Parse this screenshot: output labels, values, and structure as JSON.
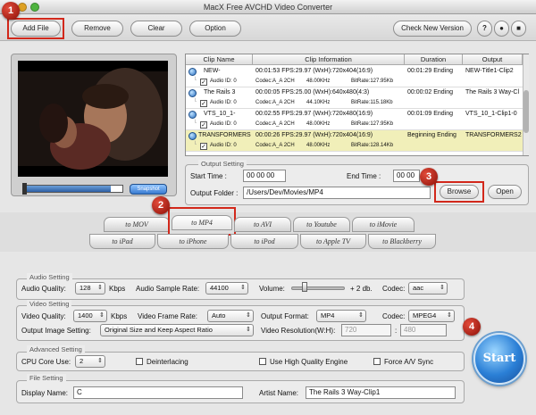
{
  "window": {
    "title": "MacX Free AVCHD Video Converter"
  },
  "toolbar": {
    "add_file": "Add File",
    "remove": "Remove",
    "clear": "Clear",
    "option": "Option",
    "check_version": "Check New Version"
  },
  "callouts": [
    "1",
    "2",
    "3",
    "4"
  ],
  "preview": {
    "snapshot_label": "Snapshot",
    "progress": 0.88
  },
  "table": {
    "headers": [
      "Clip Name",
      "Clip Information",
      "Duration",
      "Output"
    ],
    "rows": [
      {
        "name": "NEW-",
        "info": "00:01:53  FPS:29.97  (WxH):720x404(16:9)",
        "duration": "00:01:29 Ending",
        "output": "NEW-Title1-Clip2",
        "audio_id": "Audio ID: 0",
        "codec": "Codec:A_A 2CH",
        "hz": "48.00KHz",
        "bitrate": "BitRate:127.95Kb"
      },
      {
        "name": "The Rails 3",
        "info": "00:00:05  FPS:25.00  (WxH):640x480(4:3)",
        "duration": "00:00:02 Ending",
        "output": "The Rails 3 Way-Cl",
        "audio_id": "Audio ID: 0",
        "codec": "Codec:A_A 2CH",
        "hz": "44.10KHz",
        "bitrate": "BitRate:115.18Kb"
      },
      {
        "name": "VTS_10_1-",
        "info": "00:02:55  FPS:29.97  (WxH):720x480(16:9)",
        "duration": "00:01:09 Ending",
        "output": "VTS_10_1-Clip1-0",
        "audio_id": "Audio ID: 0",
        "codec": "Codec:A_A 2CH",
        "hz": "48.00KHz",
        "bitrate": "BitRate:127.95Kb"
      },
      {
        "name": "TRANSFORMERS",
        "info": "00:00:26  FPS:29.97  (WxH):720x404(16:9)",
        "duration": "Beginning Ending",
        "output": "TRANSFORMERS2",
        "audio_id": "Audio ID: 0",
        "codec": "Codec:A_A 2CH",
        "hz": "48.00KHz",
        "bitrate": "BitRate:128.14Kb"
      }
    ]
  },
  "output_setting": {
    "title": "Output Setting",
    "start_time_label": "Start Time :",
    "start_time": "00  00  00",
    "end_time_label": "End Time :",
    "end_time": "00  00",
    "folder_label": "Output Folder :",
    "folder": "/Users/Dev/Movies/MP4",
    "browse": "Browse",
    "open": "Open"
  },
  "format_tabs_row1": [
    "to MOV",
    "to MP4",
    "to AVI",
    "to Youtube",
    "to iMovie"
  ],
  "format_tabs_row2": [
    "to iPad",
    "to iPhone",
    "to iPod",
    "to Apple TV",
    "to Blackberry"
  ],
  "audio": {
    "title": "Audio Setting",
    "quality_label": "Audio Quality:",
    "quality": "128",
    "kbps": "Kbps",
    "sample_rate_label": "Audio Sample Rate:",
    "sample_rate": "44100",
    "volume_label": "Volume:",
    "volume_value": "+ 2 db.",
    "codec_label": "Codec:",
    "codec": "aac"
  },
  "video": {
    "title": "Video Setting",
    "quality_label": "Video Quality:",
    "quality": "1400",
    "kbps": "Kbps",
    "frame_rate_label": "Video Frame Rate:",
    "frame_rate": "Auto",
    "format_label": "Output Format:",
    "format": "MP4",
    "codec_label": "Codec:",
    "codec": "MPEG4",
    "image_setting_label": "Output Image Setting:",
    "image_setting": "Original Size and Keep Aspect Ratio",
    "resolution_label": "Video Resolution(W:H):",
    "res_w": "720",
    "res_h": "480"
  },
  "advanced": {
    "title": "Advanced Setting",
    "cpu_label": "CPU Core Use:",
    "cpu": "2",
    "deinterlacing": "Deinterlacing",
    "high_quality": "Use High Quality Engine",
    "force_av": "Force A/V Sync"
  },
  "file": {
    "title": "File Setting",
    "display_label": "Display Name:",
    "display_name": "C",
    "artist_label": "Artist Name:",
    "artist_name": "The Rails 3 Way-Clip1"
  },
  "start_label": "Start"
}
